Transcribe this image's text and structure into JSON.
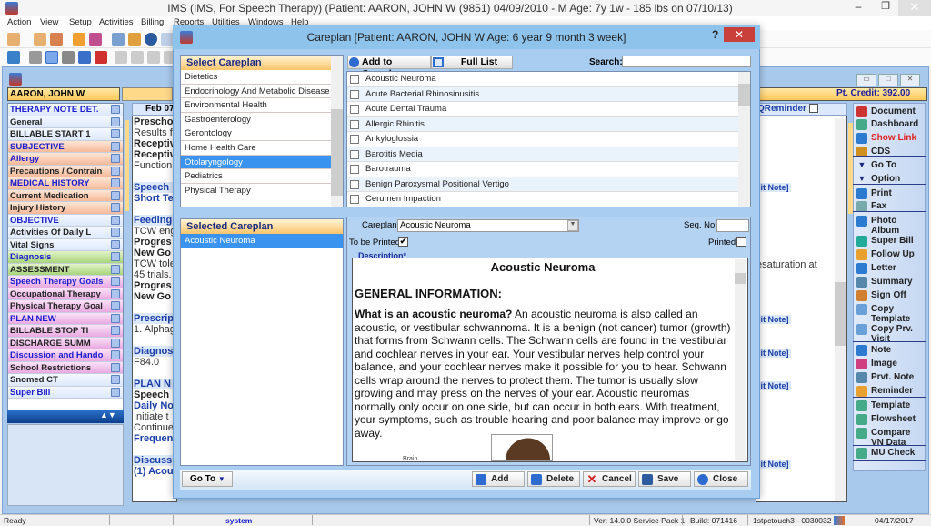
{
  "window": {
    "title": "IMS (IMS, For Speech Therapy)    (Patient: AARON, JOHN W (9851) 04/09/2010 - M Age: 7y 1w - 185 lbs on 07/10/13)",
    "min": "–",
    "max": "❐",
    "close": "✕"
  },
  "menu": [
    "Action",
    "View",
    "Setup",
    "Activities",
    "Billing",
    "Reports",
    "Utilities",
    "Windows",
    "Help"
  ],
  "patient": {
    "name": "AARON, JOHN W",
    "credit": "Pt. Credit: 392.00"
  },
  "nav": {
    "items": [
      {
        "label": "THERAPY NOTE DET.",
        "style": "g-blue",
        "color": "txt-blue"
      },
      {
        "label": "General",
        "style": "g-blue",
        "color": "txt-dark"
      },
      {
        "label": "BILLABLE START 1",
        "style": "g-blue",
        "color": "txt-dark"
      },
      {
        "label": "SUBJECTIVE",
        "style": "g-orange",
        "color": "txt-blue"
      },
      {
        "label": "Allergy",
        "style": "g-orange",
        "color": "txt-blue"
      },
      {
        "label": "Precautions / Contrain",
        "style": "g-orange",
        "color": "txt-dark"
      },
      {
        "label": "MEDICAL HISTORY",
        "style": "g-orange",
        "color": "txt-blue"
      },
      {
        "label": "Current Medication",
        "style": "g-orange",
        "color": "txt-dark"
      },
      {
        "label": "Injury History",
        "style": "g-orange",
        "color": "txt-dark"
      },
      {
        "label": "OBJECTIVE",
        "style": "g-blue",
        "color": "txt-blue"
      },
      {
        "label": "Activities Of Daily L",
        "style": "g-blue",
        "color": "txt-dark"
      },
      {
        "label": "Vital Signs",
        "style": "g-blue",
        "color": "txt-dark"
      },
      {
        "label": "Diagnosis",
        "style": "g-green",
        "color": "txt-blue"
      },
      {
        "label": "ASSESSMENT",
        "style": "g-green",
        "color": "txt-dark"
      },
      {
        "label": "Speech Therapy Goals",
        "style": "g-pink",
        "color": "txt-blue"
      },
      {
        "label": "Occupational Therapy",
        "style": "g-pink",
        "color": "txt-dark"
      },
      {
        "label": "Physical Therapy Goal",
        "style": "g-pink",
        "color": "txt-dark"
      },
      {
        "label": "PLAN NEW",
        "style": "g-pink",
        "color": "txt-blue"
      },
      {
        "label": "BILLABLE STOP TI",
        "style": "g-pink",
        "color": "txt-dark"
      },
      {
        "label": "DISCHARGE SUMM",
        "style": "g-pink",
        "color": "txt-dark"
      },
      {
        "label": "Discussion and Hando",
        "style": "g-pink",
        "color": "txt-blue"
      },
      {
        "label": "School Restrictions",
        "style": "g-pink",
        "color": "txt-dark"
      },
      {
        "label": "Snomed CT",
        "style": "g-blue",
        "color": "txt-dark"
      },
      {
        "label": "Super Bill",
        "style": "g-blue",
        "color": "txt-blue"
      }
    ],
    "arrows": "▲▼"
  },
  "note": {
    "header": "Feb 07",
    "lines": [
      {
        "t": "Prescho",
        "c": "nb"
      },
      {
        "t": "Results f",
        "c": "nn"
      },
      {
        "t": "Receptiv",
        "c": "nb"
      },
      {
        "t": "Receptiv",
        "c": "nb"
      },
      {
        "t": "Function",
        "c": "nn"
      },
      {
        "t": "",
        "c": "nn"
      },
      {
        "t": "Speech",
        "c": "nbl nsec"
      },
      {
        "t": "Short Te",
        "c": "nbl"
      },
      {
        "t": "",
        "c": "nn"
      },
      {
        "t": "Feeding",
        "c": "nbl nsec"
      },
      {
        "t": "TCW eng",
        "c": "nn"
      },
      {
        "t": "Progres",
        "c": "nb"
      },
      {
        "t": "New Go",
        "c": "nb"
      },
      {
        "t": "TCW tole",
        "c": "nn"
      },
      {
        "t": "45 trials.",
        "c": "nn"
      },
      {
        "t": "Progres",
        "c": "nb"
      },
      {
        "t": "New Go",
        "c": "nb"
      },
      {
        "t": "",
        "c": "nn"
      },
      {
        "t": "Prescrip",
        "c": "nbl nsec"
      },
      {
        "t": "1. Alphag",
        "c": "nn"
      },
      {
        "t": "",
        "c": "nn"
      },
      {
        "t": "Diagnos",
        "c": "nbl nsec"
      },
      {
        "t": "F84.0",
        "c": "nn"
      },
      {
        "t": "",
        "c": "nn"
      },
      {
        "t": "PLAN N",
        "c": "nbl nsec"
      },
      {
        "t": "Speech",
        "c": "nb"
      },
      {
        "t": "Daily No",
        "c": "nbl"
      },
      {
        "t": "Initiate t",
        "c": "nn"
      },
      {
        "t": "Continue",
        "c": "nn"
      },
      {
        "t": "Frequen",
        "c": "nbl"
      },
      {
        "t": "",
        "c": "nn"
      },
      {
        "t": "Discuss",
        "c": "nbl nsec"
      },
      {
        "t": "(1) Acou",
        "c": "nbl"
      }
    ],
    "right_header": "QReminder",
    "edit_note": "lit Note]",
    "desaturation": "esaturation at"
  },
  "side": {
    "items": [
      {
        "label": "Document",
        "color": "#222",
        "icon": "#c33"
      },
      {
        "label": "Dashboard",
        "color": "#222",
        "icon": "#4a8"
      },
      {
        "label": "Show Link",
        "color": "#e02020",
        "icon": "#2c7bd0"
      },
      {
        "label": "CDS",
        "color": "#222",
        "icon": "#d09020"
      },
      {
        "label": "Go To",
        "color": "#222",
        "icon": "arrow"
      },
      {
        "label": "Option",
        "color": "#222",
        "icon": "arrow"
      },
      {
        "label": "Print",
        "color": "#222",
        "icon": "#2c7bd0"
      },
      {
        "label": "Fax",
        "color": "#222",
        "icon": "#7aa"
      },
      {
        "label": "Photo Album",
        "color": "#222",
        "icon": "#2c7bd0"
      },
      {
        "label": "Super Bill",
        "color": "#222",
        "icon": "#2a9"
      },
      {
        "label": "Follow Up",
        "color": "#222",
        "icon": "#e8a030"
      },
      {
        "label": "Letter",
        "color": "#222",
        "icon": "#2c7bd0"
      },
      {
        "label": "Summary",
        "color": "#222",
        "icon": "#58a"
      },
      {
        "label": "Sign Off",
        "color": "#222",
        "icon": "#d08030"
      },
      {
        "label": "Copy Template",
        "color": "#222",
        "icon": "#6aa0d8"
      },
      {
        "label": "Copy Prv. Visit",
        "color": "#222",
        "icon": "#6aa0d8"
      },
      {
        "label": "Note",
        "color": "#222",
        "icon": "#2c7bd0"
      },
      {
        "label": "Image",
        "color": "#222",
        "icon": "#d04080"
      },
      {
        "label": "Prvt. Note",
        "color": "#222",
        "icon": "#58a"
      },
      {
        "label": "Reminder",
        "color": "#222",
        "icon": "#e8a030"
      },
      {
        "label": "Template",
        "color": "#222",
        "icon": "#4a8"
      },
      {
        "label": "Flowsheet",
        "color": "#222",
        "icon": "#4a8"
      },
      {
        "label": "Compare VN Data",
        "color": "#222",
        "icon": "#4a8"
      },
      {
        "label": "MU Check",
        "color": "#222",
        "icon": "#4a8"
      }
    ]
  },
  "dialog": {
    "title": "Careplan  [Patient: AARON, JOHN W  Age: 6 year 9 month 3 week]",
    "help": "?",
    "close": "✕",
    "select_header": "Select Careplan",
    "careplans": [
      "Dietetics",
      "Endocrinology And Metabolic Disease",
      "Environmental Health",
      "Gastroenterology",
      "Gerontology",
      "Home Health Care",
      "Otolaryngology",
      "Pediatrics",
      "Physical Therapy"
    ],
    "selected_careplan_index": 6,
    "add_to_careplan": "Add to Careplan",
    "full_list": "Full List",
    "search_label": "Search:",
    "search_value": "",
    "conditions": [
      "Acoustic Neuroma",
      "Acute Bacterial Rhinosinusitis",
      "Acute Dental Trauma",
      "Allergic Rhinitis",
      "Ankyloglossia",
      "Barotitis Media",
      "Barotrauma",
      "Benign Paroxysmal Positional Vertigo",
      "Cerumen Impaction"
    ],
    "selected_header": "Selected Careplan",
    "selected_items": [
      "Acoustic Neuroma"
    ],
    "careplan_label": "Careplan*",
    "careplan_value": "Acoustic Neuroma",
    "seq_label": "Seq. No.:",
    "seq_value": "",
    "to_be_printed_label": "To be Printed:",
    "to_be_printed": true,
    "printed_label": "Printed:",
    "printed": false,
    "description_label": "Description*",
    "desc_title": "Acoustic Neuroma",
    "desc_general": "GENERAL INFORMATION:",
    "desc_question": "What is an acoustic neuroma?",
    "desc_text": " An acoustic neuroma is also called an acoustic, or vestibular schwannoma. It is a benign (not cancer) tumor (growth) that forms from Schwann cells. The Schwann cells are found in the vestibular and cochlear nerves in your ear. Your vestibular nerves help control your balance, and your cochlear nerves make it possible for you to hear. Schwann cells wrap around the nerves to protect them. The tumor is usually slow growing and may press on the nerves of your ear. Acoustic neuromas normally only occur on one side, but can occur in both ears. With treatment, your symptoms, such as trouble hearing and poor balance may improve or go away.",
    "desc_img_caption": "Brain",
    "goto": "Go To",
    "buttons": {
      "add": "Add",
      "delete": "Delete",
      "cancel": "Cancel",
      "save": "Save",
      "close": "Close"
    }
  },
  "status": {
    "ready": "Ready",
    "user": "system",
    "version": "Ver: 14.0.0 Service Pack 1",
    "build": "Build: 071416",
    "server": "1stpctouch3 - 0030032",
    "date": "04/17/2017"
  }
}
